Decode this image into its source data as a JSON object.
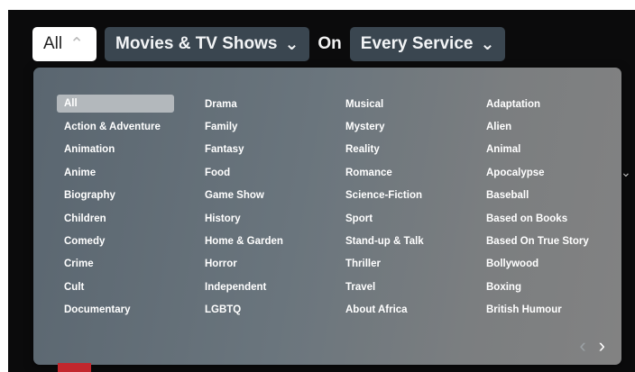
{
  "filters": {
    "type_label": "All",
    "category_label": "Movies & TV Shows",
    "on_label": "On",
    "service_label": "Every Service",
    "chevron": "⌄"
  },
  "genres": {
    "col1": [
      "All",
      "Action & Adventure",
      "Animation",
      "Anime",
      "Biography",
      "Children",
      "Comedy",
      "Crime",
      "Cult",
      "Documentary"
    ],
    "col2": [
      "Drama",
      "Family",
      "Fantasy",
      "Food",
      "Game Show",
      "History",
      "Home & Garden",
      "Horror",
      "Independent",
      "LGBTQ"
    ],
    "col3": [
      "Musical",
      "Mystery",
      "Reality",
      "Romance",
      "Science-Fiction",
      "Sport",
      "Stand-up & Talk",
      "Thriller",
      "Travel",
      "About Africa"
    ],
    "col4": [
      "Adaptation",
      "Alien",
      "Animal",
      "Apocalypse",
      "Baseball",
      "Based on Books",
      "Based On True Story",
      "Bollywood",
      "Boxing",
      "British Humour"
    ],
    "selected": "All"
  },
  "pager": {
    "prev": "‹",
    "next": "›"
  },
  "colors": {
    "dropdown_start": "#5a6670",
    "dropdown_end": "#828282",
    "pill_bg": "#3a4650"
  }
}
